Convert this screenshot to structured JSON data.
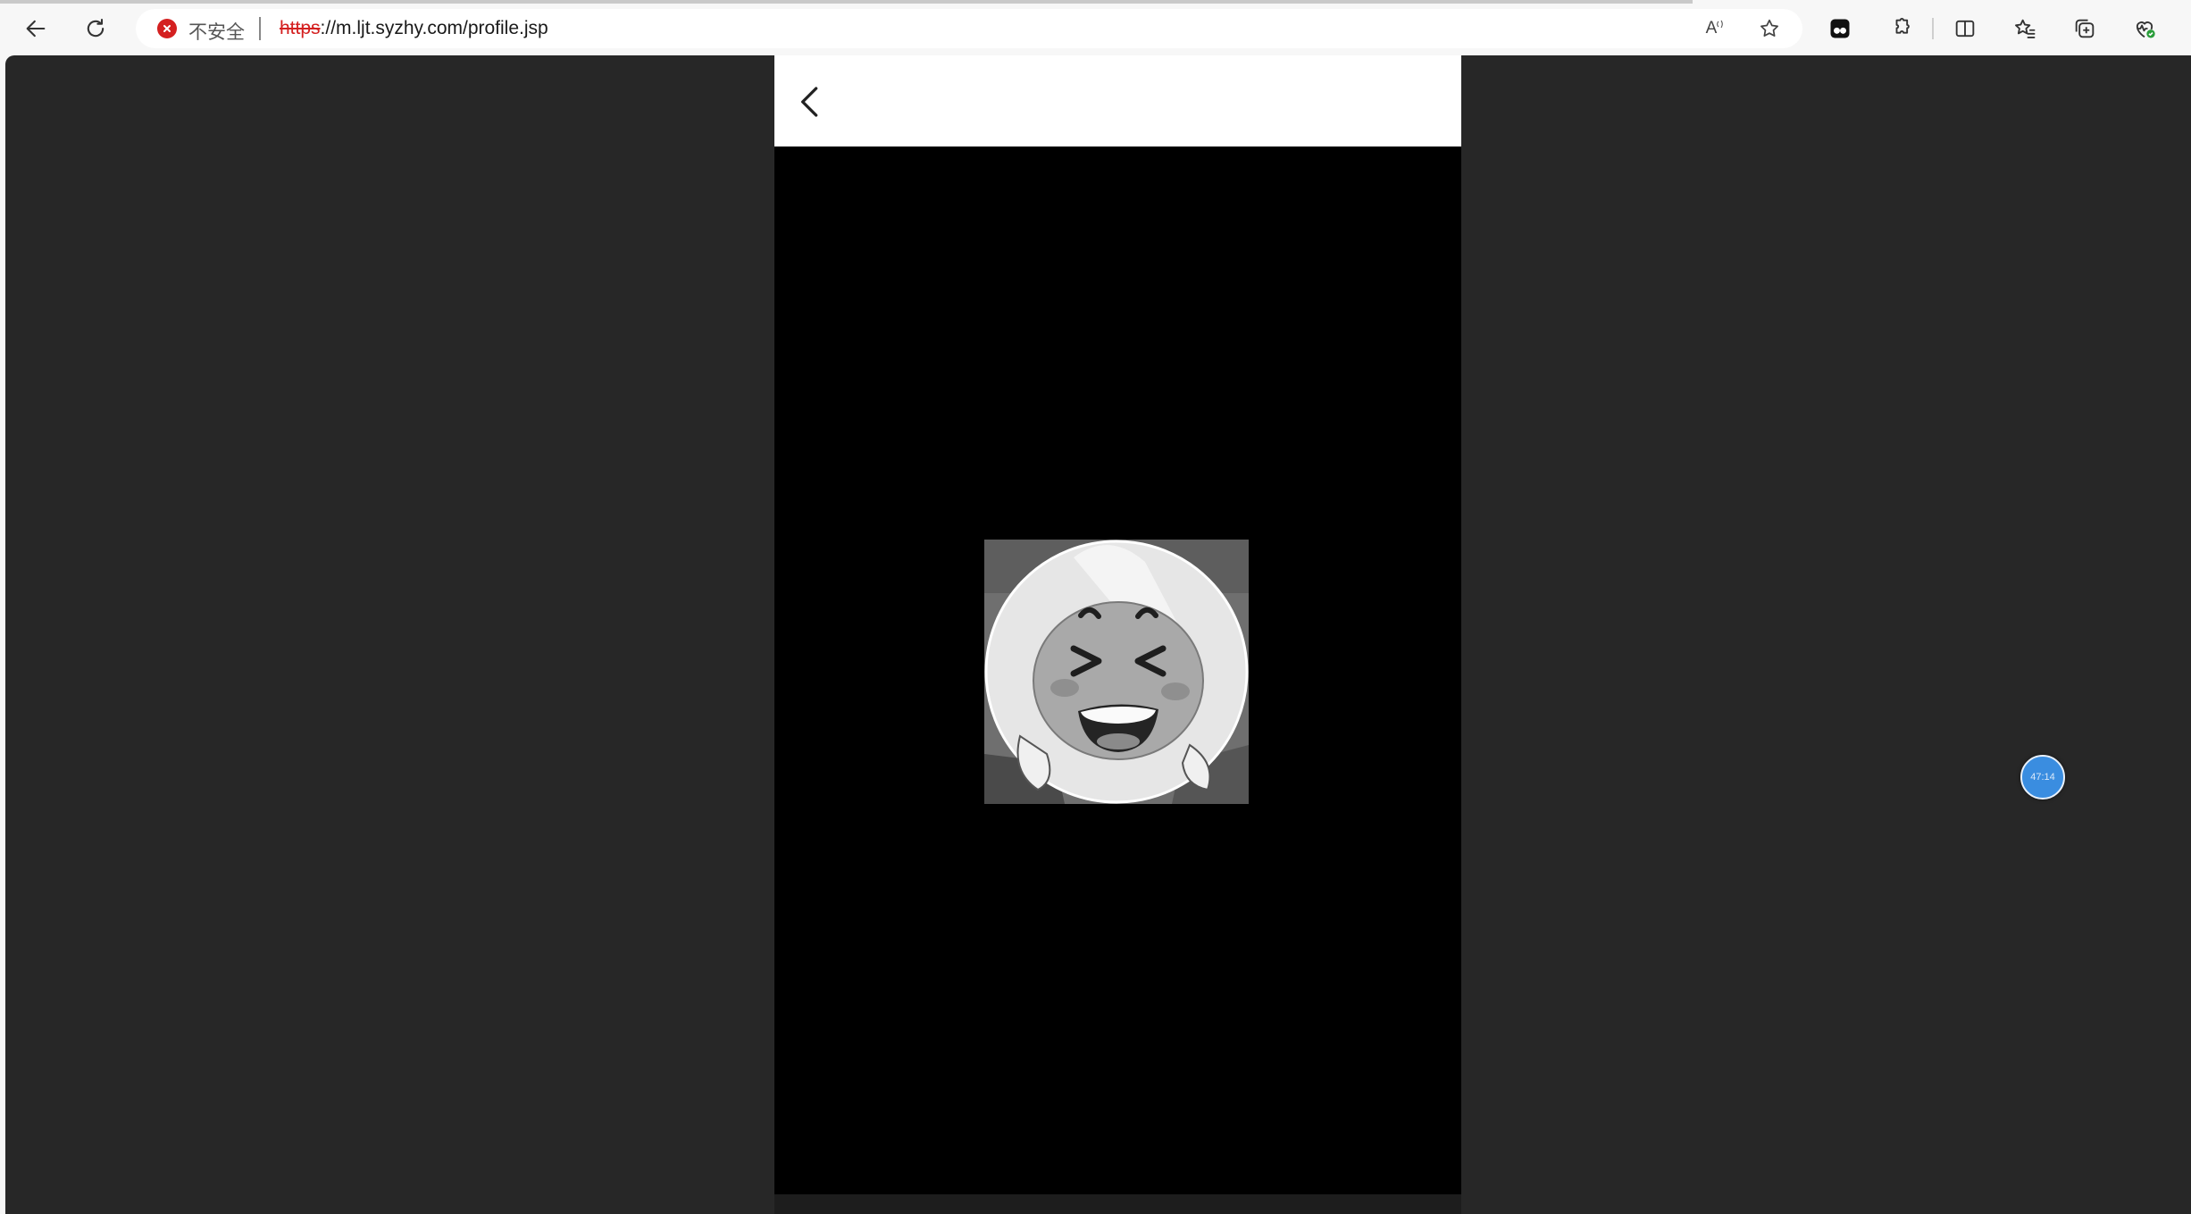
{
  "browser": {
    "security_label": "不安全",
    "url_scheme": "https",
    "url_rest": "://m.ljt.syzhy.com/profile.jsp",
    "read_aloud_label": "A",
    "icons": {
      "back": "arrow-left-icon",
      "refresh": "refresh-icon",
      "security": "not-secure-icon",
      "read_aloud": "read-aloud-icon",
      "favorite": "star-icon",
      "profile_extension": "extension-app-icon",
      "extensions": "puzzle-icon",
      "split_screen": "split-screen-icon",
      "favorites": "favorites-icon",
      "collections": "collections-icon",
      "browser_essentials": "heart-pulse-icon"
    }
  },
  "page": {
    "header": {
      "back_icon": "chevron-left-icon"
    },
    "avatar": {
      "description_icon": "laughing-face-avatar"
    }
  },
  "floating_timer": {
    "text": "47:14"
  },
  "colors": {
    "insecure_red": "#d42020",
    "timer_blue": "#3a8de0",
    "page_background": "#272727",
    "phone_background": "#000000"
  }
}
